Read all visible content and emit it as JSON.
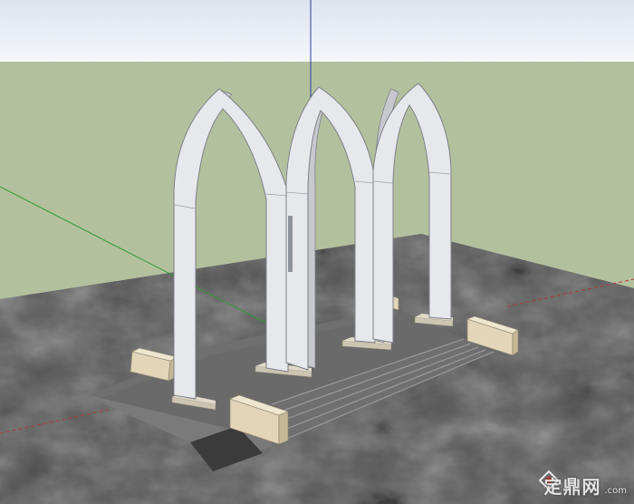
{
  "scene": {
    "colors": {
      "sky_top": "#dce4ee",
      "sky_bottom": "#f4f7fa",
      "ground": "#b3c09e",
      "terrain": "#5e5e5e",
      "paving": "#6a6a6a",
      "arch_face": "#e6e8ec",
      "arch_side": "#c7c9cf",
      "arch_edge": "#7d8088",
      "pedestal": "#ccc5b2",
      "stone_block": "#e2d5b8",
      "axis_red": "#b03a3a",
      "axis_green": "#2f9a2f",
      "axis_blue": "#2e3a9e"
    },
    "icons": {
      "watermark": "zhulong-logo-icon"
    }
  },
  "watermark": {
    "text": "定鼎网",
    "domain": ".com"
  }
}
